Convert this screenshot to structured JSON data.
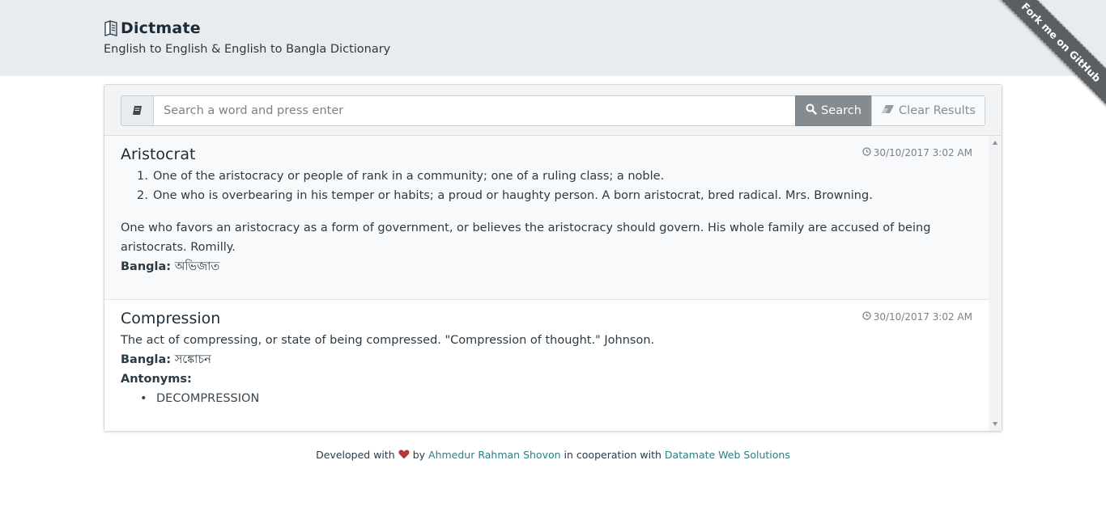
{
  "header": {
    "title": "Dictmate",
    "subtitle": "English to English & English to Bangla Dictionary",
    "logo_icon": "book-icon"
  },
  "ribbon": {
    "label": "Fork me on GitHub"
  },
  "search": {
    "placeholder": "Search a word and press enter",
    "value": "",
    "search_label": "Search",
    "clear_label": "Clear Results",
    "addon_icon": "book-icon"
  },
  "results": [
    {
      "word": "Aristocrat",
      "time": "30/10/2017 3:02 AM",
      "definitions": [
        {
          "num": "1.",
          "text": "One of the aristocracy or people of rank in a community; one of a ruling class; a noble."
        },
        {
          "num": "2.",
          "text": "One who is overbearing in his temper or habits; a proud or haughty person. A born aristocrat, bred radical. Mrs. Browning."
        }
      ],
      "paragraph_line1": "One who favors an aristocracy as a form of government, or believes the aristocracy should govern. His whole family are accused of being",
      "paragraph_line2": "aristocrats. Romilly.",
      "bangla_label": "Bangla:",
      "bangla": "অভিজাত"
    },
    {
      "word": "Compression",
      "time": "30/10/2017 3:02 AM",
      "definition": "The act of compressing, or state of being compressed. \"Compression of thought.\" Johnson.",
      "bangla_label": "Bangla:",
      "bangla": "সঙ্কোচন",
      "antonyms_label": "Antonyms:",
      "antonyms": [
        "DECOMPRESSION"
      ]
    }
  ],
  "footer": {
    "developed_with": "Developed with",
    "by": "by",
    "author": "Ahmedur Rahman Shovon",
    "cooperation": "in cooperation with",
    "company": "Datamate Web Solutions"
  },
  "colors": {
    "header_bg": "#e9ecef",
    "search_button": "#848b91",
    "link": "#2f7d84",
    "heart": "#b63a3a",
    "ribbon": "#5a5f63"
  }
}
